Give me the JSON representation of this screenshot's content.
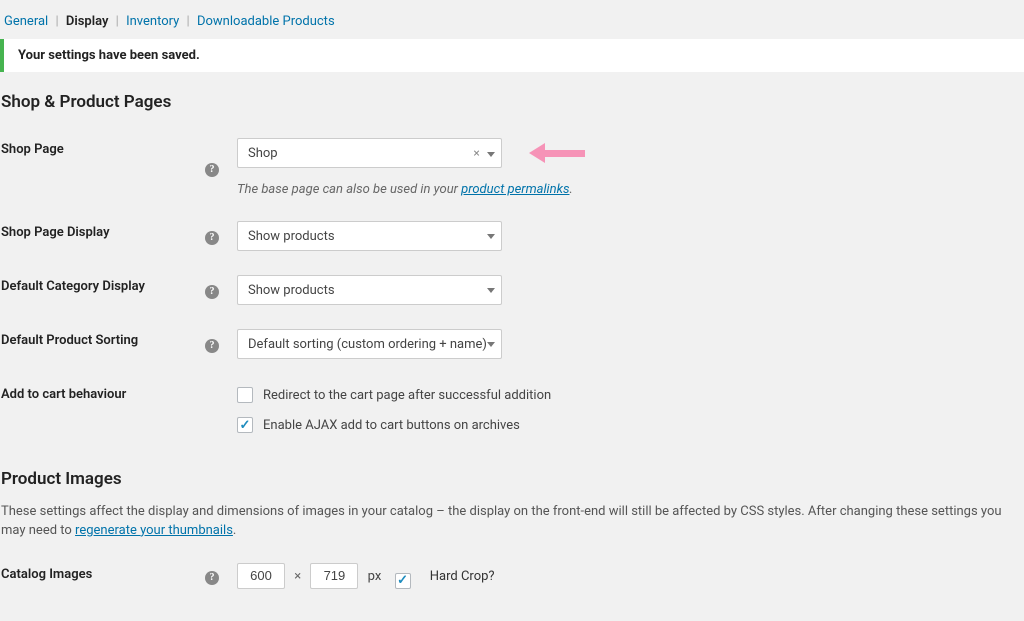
{
  "subnav": {
    "general": "General",
    "display": "Display",
    "inventory": "Inventory",
    "downloadable": "Downloadable Products"
  },
  "notice": "Your settings have been saved.",
  "section1_title": "Shop & Product Pages",
  "section2_title": "Product Images",
  "shop_page": {
    "label": "Shop Page",
    "value": "Shop",
    "desc_prefix": "The base page can also be used in your ",
    "desc_link": "product permalinks",
    "desc_suffix": "."
  },
  "shop_display": {
    "label": "Shop Page Display",
    "value": "Show products"
  },
  "cat_display": {
    "label": "Default Category Display",
    "value": "Show products"
  },
  "sorting": {
    "label": "Default Product Sorting",
    "value": "Default sorting (custom ordering + name)"
  },
  "cart_behaviour": {
    "label": "Add to cart behaviour",
    "opt_redirect": "Redirect to the cart page after successful addition",
    "opt_ajax": "Enable AJAX add to cart buttons on archives"
  },
  "images_intro_prefix": "These settings affect the display and dimensions of images in your catalog – the display on the front-end will still be affected by CSS styles. After changing these settings you may need to ",
  "images_intro_link": "regenerate your thumbnails",
  "images_intro_suffix": ".",
  "catalog_images": {
    "label": "Catalog Images",
    "w": "600",
    "h": "719",
    "px": "px",
    "hardcrop": "Hard Crop?"
  }
}
